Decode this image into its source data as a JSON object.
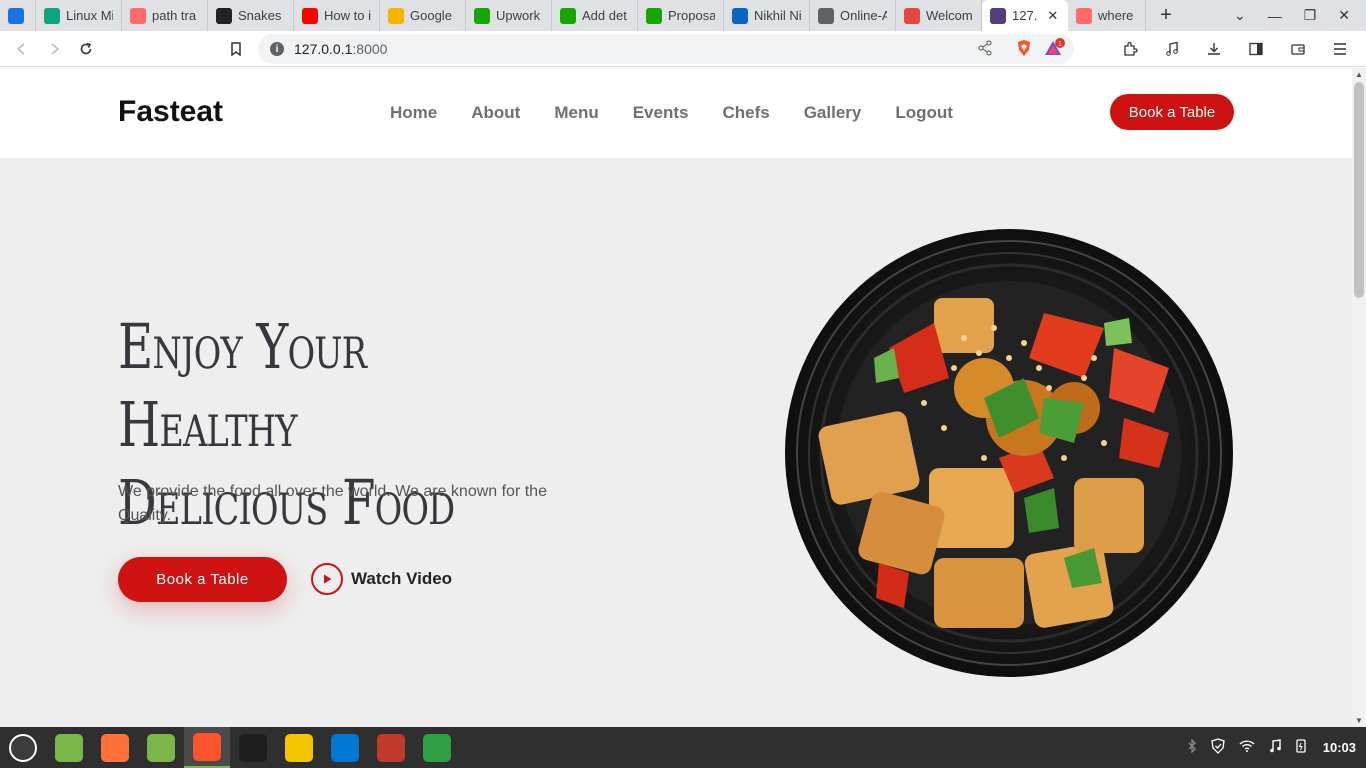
{
  "browser": {
    "tabs": [
      {
        "title": "",
        "fav_color": "#1a73e8",
        "icon": "inbox-icon"
      },
      {
        "title": "Linux Mi",
        "fav_color": "#10a37f",
        "icon": "chatgpt-icon"
      },
      {
        "title": "path tra",
        "fav_color": "#ff6b6b",
        "icon": "target-icon"
      },
      {
        "title": "Snakes a",
        "fav_color": "#222222",
        "icon": "lightning-icon"
      },
      {
        "title": "How to i",
        "fav_color": "#ff0000",
        "icon": "youtube-icon"
      },
      {
        "title": "Google",
        "fav_color": "#f4b400",
        "icon": "google-keep-icon"
      },
      {
        "title": "Upwork",
        "fav_color": "#14a800",
        "icon": "upwork-icon"
      },
      {
        "title": "Add det",
        "fav_color": "#14a800",
        "icon": "upwork-icon"
      },
      {
        "title": "Proposa",
        "fav_color": "#14a800",
        "icon": "upwork-icon"
      },
      {
        "title": "Nikhil Ni",
        "fav_color": "#0a66c2",
        "icon": "linkedin-icon"
      },
      {
        "title": "Online-A",
        "fav_color": "#5f6368",
        "icon": "globe-icon"
      },
      {
        "title": "Welcom",
        "fav_color": "#e8453c",
        "icon": "flame-icon"
      },
      {
        "title": "127.",
        "fav_color": "#563d7c",
        "icon": "bootstrap-icon",
        "active": true
      },
      {
        "title": "where is",
        "fav_color": "#ff6b6b",
        "icon": "target-icon"
      }
    ],
    "url": "127.0.0.1:8000",
    "url_host": "127.0.0.1",
    "url_port": ":8000",
    "new_tab_symbol": "+",
    "shield_badge": "1"
  },
  "site": {
    "logo": "Fasteat",
    "nav": [
      "Home",
      "About",
      "Menu",
      "Events",
      "Chefs",
      "Gallery",
      "Logout"
    ],
    "header_button": "Book a Table",
    "hero": {
      "title_line1": "Enjoy Your Healthy",
      "title_line2": "Delicious Food",
      "subtitle": "We provide the food all over the world. We are known for the Quality.",
      "cta": "Book a Table",
      "video_link": "Watch Video"
    },
    "accent": "#ce1212"
  },
  "taskbar": {
    "apps": [
      {
        "icon": "mint-menu-icon",
        "color": "#3c3c3c"
      },
      {
        "icon": "show-desktop-icon",
        "color": "#7ab648"
      },
      {
        "icon": "firefox-icon",
        "color": "#ff7139"
      },
      {
        "icon": "files-icon",
        "color": "#7ab648"
      },
      {
        "icon": "brave-icon",
        "color": "#fb542b",
        "active": true
      },
      {
        "icon": "terminal-icon",
        "color": "#1e1e1e"
      },
      {
        "icon": "bolt-app-icon",
        "color": "#f5c400"
      },
      {
        "icon": "vscode-icon",
        "color": "#0078d4"
      },
      {
        "icon": "alert-app-icon",
        "color": "#c0392b"
      },
      {
        "icon": "shield-app-icon",
        "color": "#2ea043"
      }
    ],
    "clock": "10:03"
  }
}
